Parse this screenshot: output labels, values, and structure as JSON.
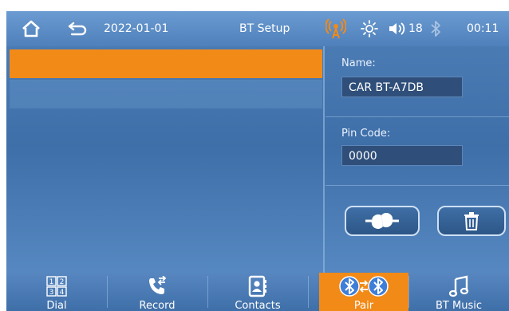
{
  "topbar": {
    "date": "2022-01-01",
    "title": "BT Setup",
    "volume": "18",
    "time": "00:11"
  },
  "panel": {
    "name_label": "Name:",
    "name_value": "CAR BT-A7DB",
    "pin_label": "Pin Code:",
    "pin_value": "0000"
  },
  "device_list": {
    "selected_index": 0,
    "rows": [
      "",
      ""
    ]
  },
  "tabs": [
    {
      "label": "Dial",
      "icon": "dialpad-icon"
    },
    {
      "label": "Record",
      "icon": "call-log-icon"
    },
    {
      "label": "Contacts",
      "icon": "contacts-icon"
    },
    {
      "label": "Pair",
      "icon": "bluetooth-pair-icon",
      "active": true
    },
    {
      "label": "BT Music",
      "icon": "music-note-icon"
    }
  ],
  "colors": {
    "accent": "#f28a17",
    "background": "#4f7fb7",
    "field": "#2f4f7a"
  }
}
